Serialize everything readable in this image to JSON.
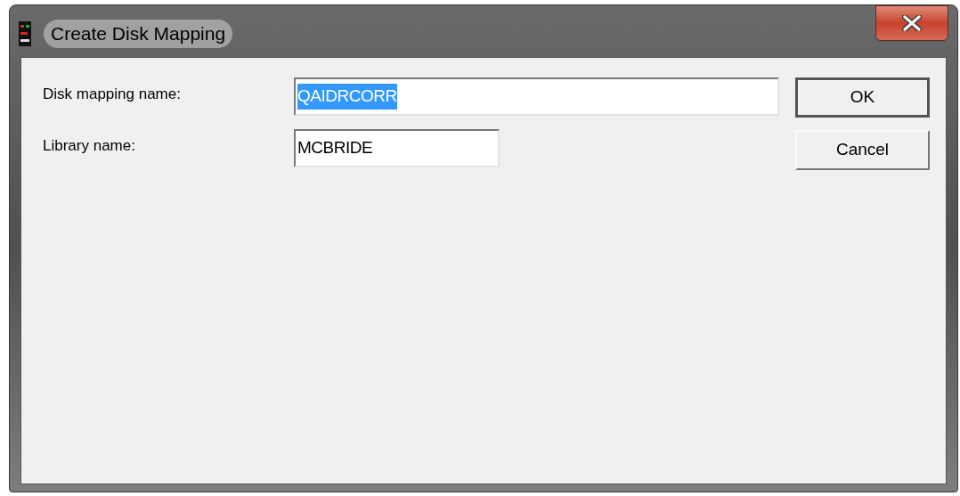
{
  "window": {
    "title": "Create Disk Mapping"
  },
  "fields": [
    {
      "label": "Disk mapping name:",
      "value": "QAIDRCORR",
      "selected": true
    },
    {
      "label": "Library name:",
      "value": "MCBRIDE",
      "selected": false
    }
  ],
  "buttons": [
    {
      "label": "OK",
      "default": true
    },
    {
      "label": "Cancel",
      "default": false
    }
  ]
}
